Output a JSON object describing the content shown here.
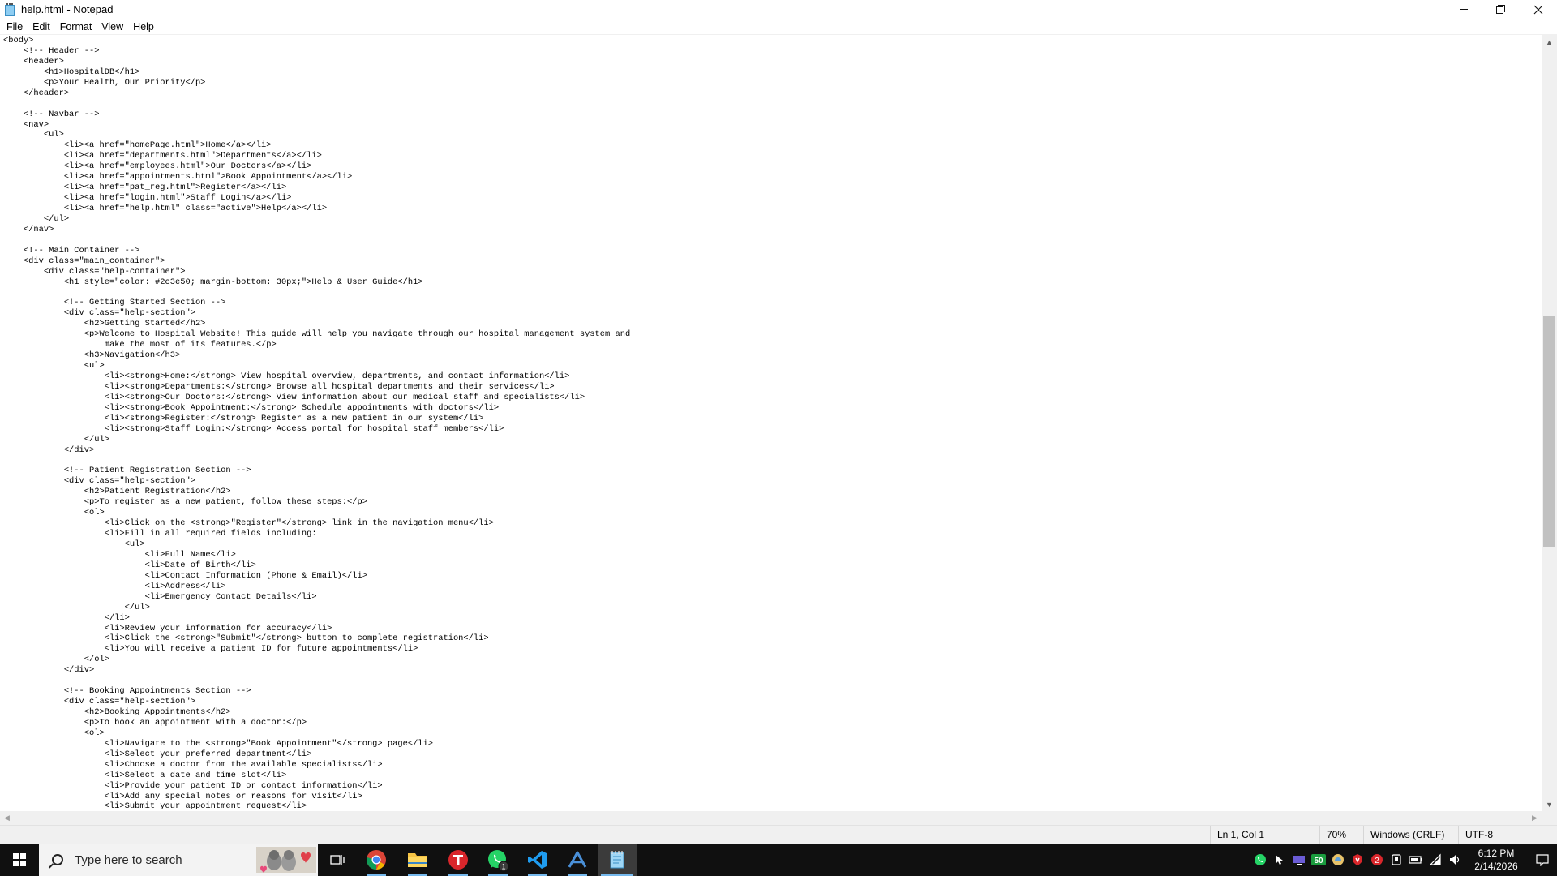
{
  "window": {
    "title": "help.html - Notepad",
    "app_icon": "notepad-icon"
  },
  "menu": [
    "File",
    "Edit",
    "Format",
    "View",
    "Help"
  ],
  "editor": {
    "lines": [
      "<body>",
      "    <!-- Header -->",
      "    <header>",
      "        <h1>HospitalDB</h1>",
      "        <p>Your Health, Our Priority</p>",
      "    </header>",
      "",
      "    <!-- Navbar -->",
      "    <nav>",
      "        <ul>",
      "            <li><a href=\"homePage.html\">Home</a></li>",
      "            <li><a href=\"departments.html\">Departments</a></li>",
      "            <li><a href=\"employees.html\">Our Doctors</a></li>",
      "            <li><a href=\"appointments.html\">Book Appointment</a></li>",
      "            <li><a href=\"pat_reg.html\">Register</a></li>",
      "            <li><a href=\"login.html\">Staff Login</a></li>",
      "            <li><a href=\"help.html\" class=\"active\">Help</a></li>",
      "        </ul>",
      "    </nav>",
      "",
      "    <!-- Main Container -->",
      "    <div class=\"main_container\">",
      "        <div class=\"help-container\">",
      "            <h1 style=\"color: #2c3e50; margin-bottom: 30px;\">Help & User Guide</h1>",
      "",
      "            <!-- Getting Started Section -->",
      "            <div class=\"help-section\">",
      "                <h2>Getting Started</h2>",
      "                <p>Welcome to Hospital Website! This guide will help you navigate through our hospital management system and",
      "                    make the most of its features.</p>",
      "                <h3>Navigation</h3>",
      "                <ul>",
      "                    <li><strong>Home:</strong> View hospital overview, departments, and contact information</li>",
      "                    <li><strong>Departments:</strong> Browse all hospital departments and their services</li>",
      "                    <li><strong>Our Doctors:</strong> View information about our medical staff and specialists</li>",
      "                    <li><strong>Book Appointment:</strong> Schedule appointments with doctors</li>",
      "                    <li><strong>Register:</strong> Register as a new patient in our system</li>",
      "                    <li><strong>Staff Login:</strong> Access portal for hospital staff members</li>",
      "                </ul>",
      "            </div>",
      "",
      "            <!-- Patient Registration Section -->",
      "            <div class=\"help-section\">",
      "                <h2>Patient Registration</h2>",
      "                <p>To register as a new patient, follow these steps:</p>",
      "                <ol>",
      "                    <li>Click on the <strong>\"Register\"</strong> link in the navigation menu</li>",
      "                    <li>Fill in all required fields including:",
      "                        <ul>",
      "                            <li>Full Name</li>",
      "                            <li>Date of Birth</li>",
      "                            <li>Contact Information (Phone & Email)</li>",
      "                            <li>Address</li>",
      "                            <li>Emergency Contact Details</li>",
      "                        </ul>",
      "                    </li>",
      "                    <li>Review your information for accuracy</li>",
      "                    <li>Click the <strong>\"Submit\"</strong> button to complete registration</li>",
      "                    <li>You will receive a patient ID for future appointments</li>",
      "                </ol>",
      "            </div>",
      "",
      "            <!-- Booking Appointments Section -->",
      "            <div class=\"help-section\">",
      "                <h2>Booking Appointments</h2>",
      "                <p>To book an appointment with a doctor:</p>",
      "                <ol>",
      "                    <li>Navigate to the <strong>\"Book Appointment\"</strong> page</li>",
      "                    <li>Select your preferred department</li>",
      "                    <li>Choose a doctor from the available specialists</li>",
      "                    <li>Select a date and time slot</li>",
      "                    <li>Provide your patient ID or contact information</li>",
      "                    <li>Add any special notes or reasons for visit</li>",
      "                    <li>Submit your appointment request</li>"
    ]
  },
  "status": {
    "position": "Ln 1, Col 1",
    "zoom": "70%",
    "line_ending": "Windows (CRLF)",
    "encoding": "UTF-8"
  },
  "taskbar": {
    "search_placeholder": "Type here to search",
    "apps": [
      "task-view-icon",
      "chrome-icon",
      "file-explorer-icon",
      "t-app-icon",
      "whatsapp-icon",
      "vscode-icon",
      "arc-icon",
      "notepad-icon"
    ],
    "clock_time": "6:12 PM",
    "clock_date": "2/14/2026",
    "tray_badge_1": "50",
    "tray_badge_2": "2",
    "whatsapp_badge": "1"
  }
}
